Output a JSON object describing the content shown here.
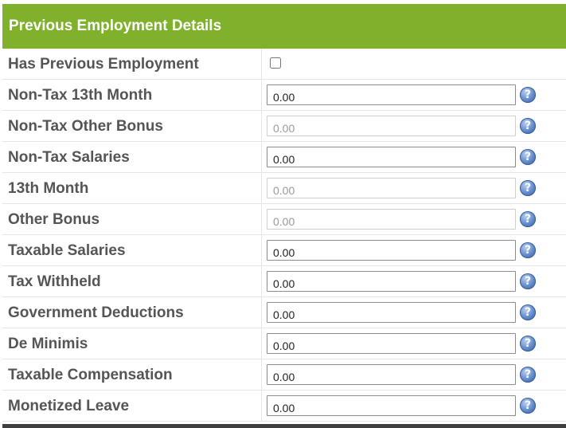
{
  "header": {
    "title": "Previous Employment Details"
  },
  "has_previous_employment": {
    "label": "Has Previous Employment",
    "checked": false
  },
  "fields": [
    {
      "label": "Non-Tax 13th Month",
      "value": "0.00",
      "disabled": false
    },
    {
      "label": "Non-Tax Other Bonus",
      "value": "0.00",
      "disabled": true
    },
    {
      "label": "Non-Tax Salaries",
      "value": "0.00",
      "disabled": false
    },
    {
      "label": "13th Month",
      "value": "0.00",
      "disabled": true
    },
    {
      "label": "Other Bonus",
      "value": "0.00",
      "disabled": true
    },
    {
      "label": "Taxable Salaries",
      "value": "0.00",
      "disabled": false
    },
    {
      "label": "Tax Withheld",
      "value": "0.00",
      "disabled": false
    },
    {
      "label": "Government Deductions",
      "value": "0.00",
      "disabled": false
    },
    {
      "label": "De Minimis",
      "value": "0.00",
      "disabled": false
    },
    {
      "label": "Taxable Compensation",
      "value": "0.00",
      "disabled": false
    },
    {
      "label": "Monetized Leave",
      "value": "0.00",
      "disabled": false
    }
  ],
  "help_icon": {
    "glyph": "?",
    "icon": "question-circle-icon"
  },
  "colors": {
    "header_bg": "#7fb12b",
    "header_text": "#ffffff",
    "label_text": "#555555",
    "help_icon": "#4a74b8",
    "footer_bar": "#3f3f3f"
  }
}
